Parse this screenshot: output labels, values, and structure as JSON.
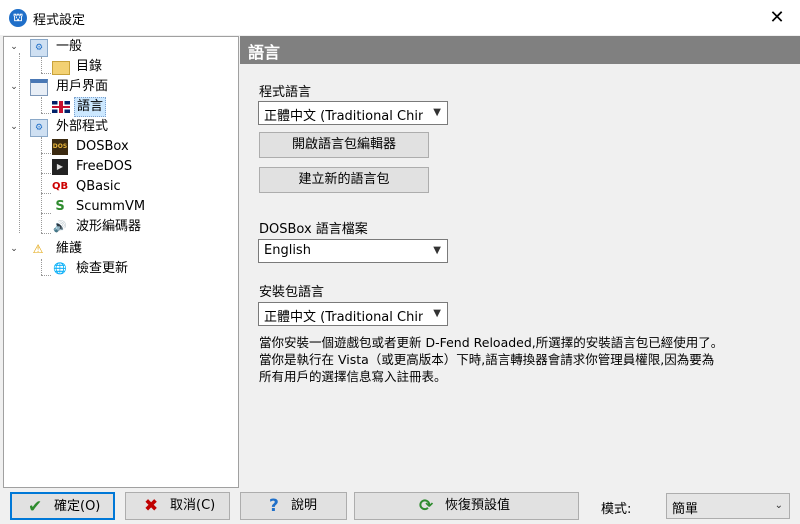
{
  "window": {
    "title": "程式設定",
    "app_icon_glyph": "⛫"
  },
  "tree": {
    "items": [
      {
        "label": "一般",
        "icon": "settings-icon",
        "icon_glyph": "⚙"
      },
      {
        "label": "目錄",
        "icon": "folder-icon",
        "icon_glyph": ""
      },
      {
        "label": "用戶界面",
        "icon": "window-icon",
        "icon_glyph": ""
      },
      {
        "label": "語言",
        "icon": "uk-flag-icon",
        "icon_glyph": ""
      },
      {
        "label": "外部程式",
        "icon": "programs-icon",
        "icon_glyph": "⚙"
      },
      {
        "label": "DOSBox",
        "icon": "dosbox-icon",
        "icon_glyph": "DOS"
      },
      {
        "label": "FreeDOS",
        "icon": "terminal-icon",
        "icon_glyph": "▶"
      },
      {
        "label": "QBasic",
        "icon": "qbasic-icon",
        "icon_glyph": "QB"
      },
      {
        "label": "ScummVM",
        "icon": "scummvm-icon",
        "icon_glyph": "S"
      },
      {
        "label": "波形編碼器",
        "icon": "speaker-icon",
        "icon_glyph": "🔊"
      },
      {
        "label": "維護",
        "icon": "maintenance-icon",
        "icon_glyph": "⚠"
      },
      {
        "label": "檢查更新",
        "icon": "globe-icon",
        "icon_glyph": "🌐"
      }
    ]
  },
  "panel": {
    "title": "語言",
    "program_language_label": "程式語言",
    "program_language_value": "正體中文 (Traditional Chinese)",
    "open_editor_button": "開啟語言包編輯器",
    "new_pack_button": "建立新的語言包",
    "dosbox_language_label": "DOSBox 語言檔案",
    "dosbox_language_value": "English",
    "installer_language_label": "安裝包語言",
    "installer_language_value": "正體中文 (Traditional Chinese)",
    "info_line1": "當你安裝一個遊戲包或者更新 D-Fend Reloaded,所選擇的安裝語言包已經使用了。",
    "info_line2": "當你是執行在 Vista（或更高版本）下時,語言轉換器會請求你管理員權限,因為要為",
    "info_line3": "所有用戶的選擇信息寫入註冊表。"
  },
  "footer": {
    "ok_label": "確定(O)",
    "cancel_label": "取消(C)",
    "help_label": "說明",
    "reset_label": "恢復預設值",
    "mode_label": "模式:",
    "mode_value": "簡單"
  },
  "colors": {
    "accent": "#0078d7",
    "header_band": "#808080",
    "selection": "#cce8ff"
  }
}
